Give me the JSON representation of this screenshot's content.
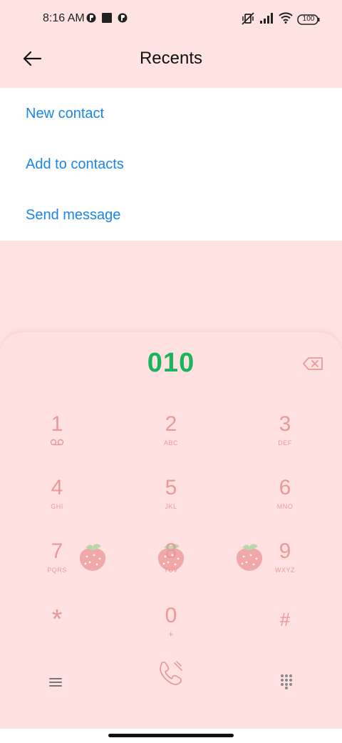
{
  "status_bar": {
    "time": "8:16 AM",
    "battery": "100"
  },
  "header": {
    "title": "Recents"
  },
  "menu": {
    "items": [
      {
        "label": "New contact"
      },
      {
        "label": "Add to contacts"
      },
      {
        "label": "Send message"
      }
    ]
  },
  "dialer": {
    "number": "010",
    "keys": [
      {
        "digit": "1",
        "letters": ""
      },
      {
        "digit": "2",
        "letters": "ABC"
      },
      {
        "digit": "3",
        "letters": "DEF"
      },
      {
        "digit": "4",
        "letters": "GHI"
      },
      {
        "digit": "5",
        "letters": "JKL"
      },
      {
        "digit": "6",
        "letters": "MNO"
      },
      {
        "digit": "7",
        "letters": "PQRS"
      },
      {
        "digit": "8",
        "letters": "TUV"
      },
      {
        "digit": "9",
        "letters": "WXYZ"
      },
      {
        "digit": "*",
        "letters": ""
      },
      {
        "digit": "0",
        "letters": "+"
      },
      {
        "digit": "#",
        "letters": ""
      }
    ]
  },
  "colors": {
    "accent_blue": "#1a86e8",
    "number_green": "#19b55a",
    "key_pink": "#e89a9a",
    "background": "#ffe3e3"
  },
  "icons": [
    "back-arrow-icon",
    "backspace-icon",
    "voicemail-icon",
    "call-icon",
    "menu-icon",
    "dialpad-grid-icon",
    "strawberry-icon"
  ]
}
